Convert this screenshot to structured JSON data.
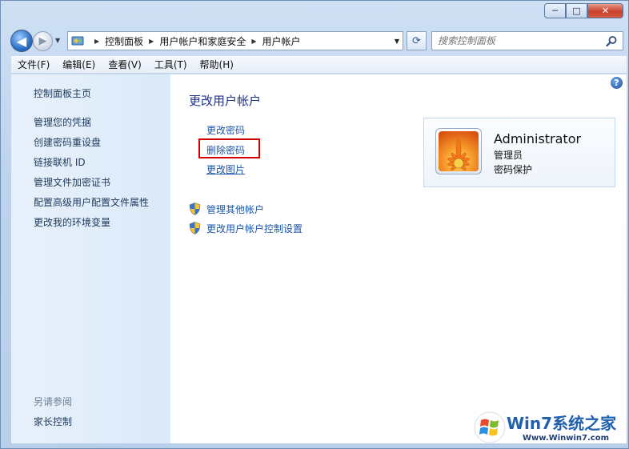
{
  "window": {
    "caption": {
      "minimize": "─",
      "maximize": "□",
      "close": "✕"
    }
  },
  "nav": {
    "back_glyph": "◀",
    "forward_glyph": "▶",
    "history_glyph": "▼",
    "breadcrumbs": [
      "控制面板",
      "用户帐户和家庭安全",
      "用户帐户"
    ],
    "breadcrumb_sep": "▶",
    "dropdown_glyph": "▼",
    "refresh_glyph": "⟳",
    "search_placeholder": "搜索控制面板"
  },
  "menubar": [
    "文件(F)",
    "编辑(E)",
    "查看(V)",
    "工具(T)",
    "帮助(H)"
  ],
  "left_pane": {
    "home": "控制面板主页",
    "links": [
      "管理您的凭据",
      "创建密码重设盘",
      "链接联机 ID",
      "管理文件加密证书",
      "配置高级用户配置文件属性",
      "更改我的环境变量"
    ],
    "see_also_title": "另请参阅",
    "see_also_links": [
      "家长控制"
    ]
  },
  "main": {
    "title": "更改用户帐户",
    "tasks": [
      "更改密码",
      "删除密码",
      "更改图片"
    ],
    "admin_tasks": [
      "管理其他帐户",
      "更改用户帐户控制设置"
    ],
    "help": "?"
  },
  "user": {
    "name": "Administrator",
    "role": "管理员",
    "status": "密码保护"
  },
  "watermark": {
    "title": "Win7系统之家",
    "url": "Www.Winwin7.com"
  },
  "colors": {
    "link": "#1e56a8",
    "title": "#1e3287",
    "highlight": "#d40000",
    "left_pane": "#dbe9f8"
  }
}
